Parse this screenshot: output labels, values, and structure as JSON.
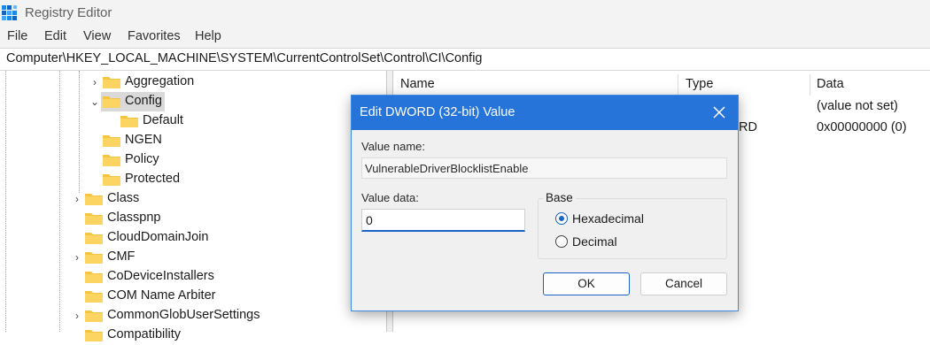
{
  "window": {
    "title": "Registry Editor"
  },
  "menu": {
    "items": [
      "File",
      "Edit",
      "View",
      "Favorites",
      "Help"
    ]
  },
  "address": {
    "path": "Computer\\HKEY_LOCAL_MACHINE\\SYSTEM\\CurrentControlSet\\Control\\CI\\Config"
  },
  "tree": {
    "items": [
      {
        "label": "Aggregation",
        "expander": "collapsed"
      },
      {
        "label": "Config",
        "expander": "expanded",
        "selected": true
      },
      {
        "label": "Default",
        "expander": "none"
      },
      {
        "label": "NGEN",
        "expander": "none"
      },
      {
        "label": "Policy",
        "expander": "none"
      },
      {
        "label": "Protected",
        "expander": "none"
      },
      {
        "label": "Class",
        "expander": "collapsed"
      },
      {
        "label": "Classpnp",
        "expander": "none"
      },
      {
        "label": "CloudDomainJoin",
        "expander": "none"
      },
      {
        "label": "CMF",
        "expander": "collapsed"
      },
      {
        "label": "CoDeviceInstallers",
        "expander": "none"
      },
      {
        "label": "COM Name Arbiter",
        "expander": "none"
      },
      {
        "label": "CommonGlobUserSettings",
        "expander": "collapsed"
      },
      {
        "label": "Compatibility",
        "expander": "none"
      }
    ]
  },
  "list": {
    "columns": [
      "Name",
      "Type",
      "Data"
    ],
    "rows": [
      {
        "type": "",
        "data": "(value not set)"
      },
      {
        "type": "RD",
        "data": "0x00000000 (0)"
      }
    ]
  },
  "dialog": {
    "title": "Edit DWORD (32-bit) Value",
    "value_name_label": "Value name:",
    "value_name": "VulnerableDriverBlocklistEnable",
    "value_data_label": "Value data:",
    "value_data": "0",
    "base_label": "Base",
    "base_options": [
      "Hexadecimal",
      "Decimal"
    ],
    "base_selected": "Hexadecimal",
    "ok_label": "OK",
    "cancel_label": "Cancel"
  },
  "colors": {
    "accent": "#2674d9",
    "folder": "#f5c542",
    "selection": "#d9d9d9"
  }
}
